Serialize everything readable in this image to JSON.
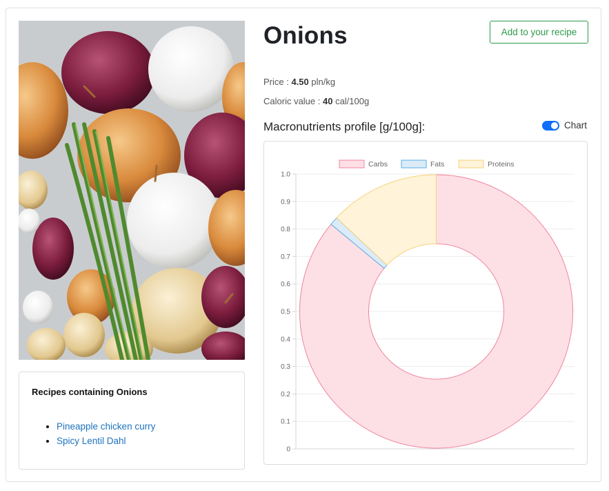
{
  "product": {
    "name": "Onions",
    "add_button_label": "Add to your recipe",
    "price_label": "Price : ",
    "price_value": "4.50",
    "price_unit": " pln/kg",
    "caloric_label": "Caloric value : ",
    "caloric_value": "40",
    "caloric_unit": " cal/100g"
  },
  "macros": {
    "title": "Macronutrients profile [g/100g]:",
    "toggle_label": "Chart",
    "toggle_on": true
  },
  "recipes": {
    "title": "Recipes containing Onions",
    "items": [
      "Pineapple chicken curry",
      "Spicy Lentil Dahl"
    ]
  },
  "colors": {
    "carbs_fill": "#fde0e6",
    "carbs_stroke": "#f0849c",
    "fats_fill": "#dcebf8",
    "fats_stroke": "#5aaee6",
    "proteins_fill": "#fff3d9",
    "proteins_stroke": "#f7d27a",
    "accent": "#0d6efd",
    "success": "#2e9a4a"
  },
  "chart_data": {
    "type": "pie",
    "labels": [
      "Carbs",
      "Fats",
      "Proteins"
    ],
    "values": [
      0.86,
      0.01,
      0.13
    ],
    "y_ticks": [
      "1.0",
      "0.9",
      "0.8",
      "0.7",
      "0.6",
      "0.5",
      "0.4",
      "0.3",
      "0.2",
      "0.1",
      "0"
    ],
    "ylim": [
      0,
      1.0
    ],
    "legend_position": "top",
    "grid": true
  }
}
